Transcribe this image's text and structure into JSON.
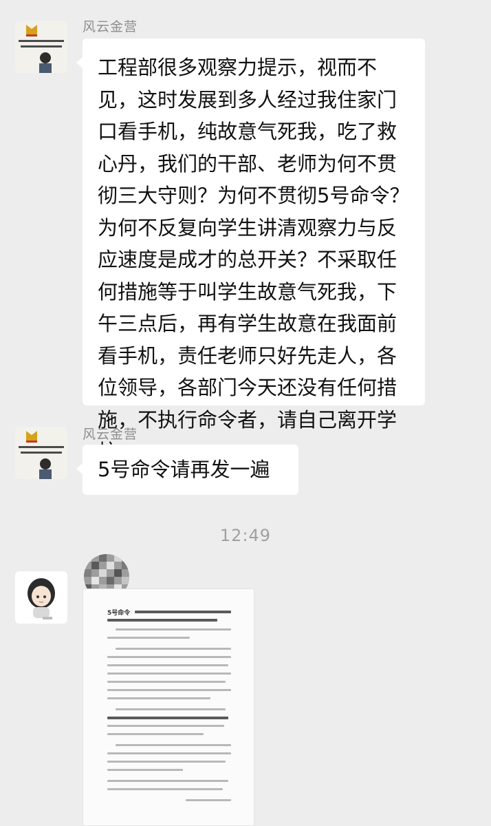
{
  "messages": [
    {
      "sender": "风云金营",
      "text": "工程部很多观察力提示，视而不见，这时发展到多人经过我住家门口看手机，纯故意气死我，吃了救心丹，我们的干部、老师为何不贯彻三大守则？为何不贯彻5号命令？为何不反复向学生讲清观察力与反应速度是成才的总开关？不采取任何措施等于叫学生故意气死我，下午三点后，再有学生故意在我面前看手机，责任老师只好先走人，各位领导，各部门今天还没有任何措施，不执行命令者，请自己离开学校。"
    },
    {
      "sender": "风云金营",
      "text": "5号命令请再发一遍"
    }
  ],
  "timestamp": "12:49",
  "image_message": {
    "doc_heading": "5号命令"
  },
  "colors": {
    "background": "#ededed",
    "bubble": "#ffffff",
    "sender_name": "#8e8e8e",
    "timestamp": "#a0a0a0"
  }
}
